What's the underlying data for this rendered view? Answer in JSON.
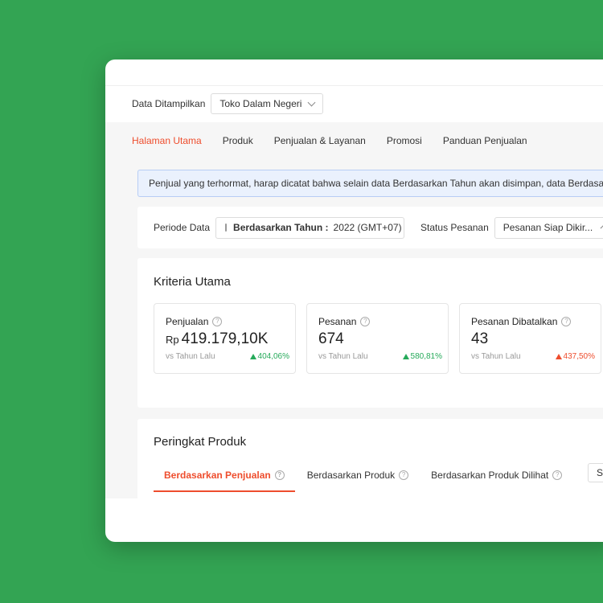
{
  "header": {
    "data_label": "Data Ditampilkan",
    "shop_select": "Toko Dalam Negeri"
  },
  "nav": {
    "items": [
      "Halaman Utama",
      "Produk",
      "Penjualan & Layanan",
      "Promosi",
      "Panduan Penjualan"
    ],
    "active_index": 0
  },
  "notice": {
    "text": "Penjual yang terhormat, harap dicatat bahwa selain data Berdasarkan Tahun akan disimpan, data Berdasarkan"
  },
  "filters": {
    "period_label": "Periode Data",
    "period_type": "Berdasarkan Tahun :",
    "period_value": "2022 (GMT+07)",
    "status_label": "Status Pesanan",
    "status_value": "Pesanan Siap Dikir..."
  },
  "kriteria": {
    "title": "Kriteria Utama",
    "metrics": [
      {
        "title": "Penjualan",
        "currency": "Rp",
        "value": "419.179,10K",
        "compare": "vs Tahun Lalu",
        "change": "404,06%",
        "trend": "up",
        "color": "#26aa5a"
      },
      {
        "title": "Pesanan",
        "currency": "",
        "value": "674",
        "compare": "vs Tahun Lalu",
        "change": "580,81%",
        "trend": "up",
        "color": "#26aa5a"
      },
      {
        "title": "Pesanan Dibatalkan",
        "currency": "",
        "value": "43",
        "compare": "vs Tahun Lalu",
        "change": "437,50%",
        "trend": "up",
        "color": "#ee4d2d"
      }
    ]
  },
  "peringkat": {
    "title": "Peringkat Produk",
    "tabs": [
      "Berdasarkan Penjualan",
      "Berdasarkan Produk",
      "Berdasarkan Produk Dilihat"
    ],
    "active_index": 0,
    "select_value": "Se"
  },
  "colors": {
    "background": "#33a453",
    "accent": "#ee4d2d",
    "positive": "#26aa5a",
    "notice_bg": "#eaf1fd"
  }
}
